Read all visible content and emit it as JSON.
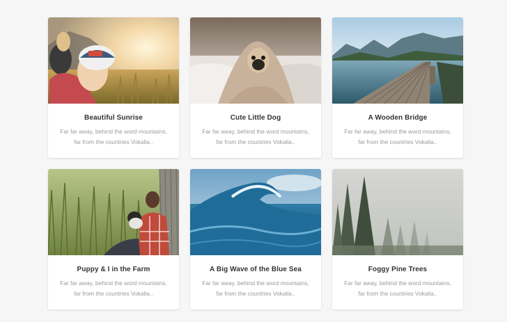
{
  "cards": [
    {
      "title": "Beautiful Sunrise",
      "text": "Far far away, behind the word mountains, far from the countries Vokalia..",
      "image_icon": "sunrise-couple-image"
    },
    {
      "title": "Cute Little Dog",
      "text": "Far far away, behind the word mountains, far from the countries Vokalia..",
      "image_icon": "pug-in-blanket-image"
    },
    {
      "title": "A Wooden Bridge",
      "text": "Far far away, behind the word mountains, far from the countries Vokalia..",
      "image_icon": "wooden-pier-lake-image"
    },
    {
      "title": "Puppy & I in the Farm",
      "text": "Far far away, behind the word mountains, far from the countries Vokalia..",
      "image_icon": "man-with-puppy-in-grass-image"
    },
    {
      "title": "A Big Wave of the Blue Sea",
      "text": "Far far away, behind the word mountains, far from the countries Vokalia..",
      "image_icon": "ocean-wave-image"
    },
    {
      "title": "Foggy Pine Trees",
      "text": "Far far away, behind the word mountains, far from the countries Vokalia..",
      "image_icon": "foggy-forest-image"
    }
  ],
  "colors": {
    "page_background": "#f6f6f6",
    "card_background": "#ffffff",
    "title": "#333333",
    "text": "#9a9a9a"
  }
}
